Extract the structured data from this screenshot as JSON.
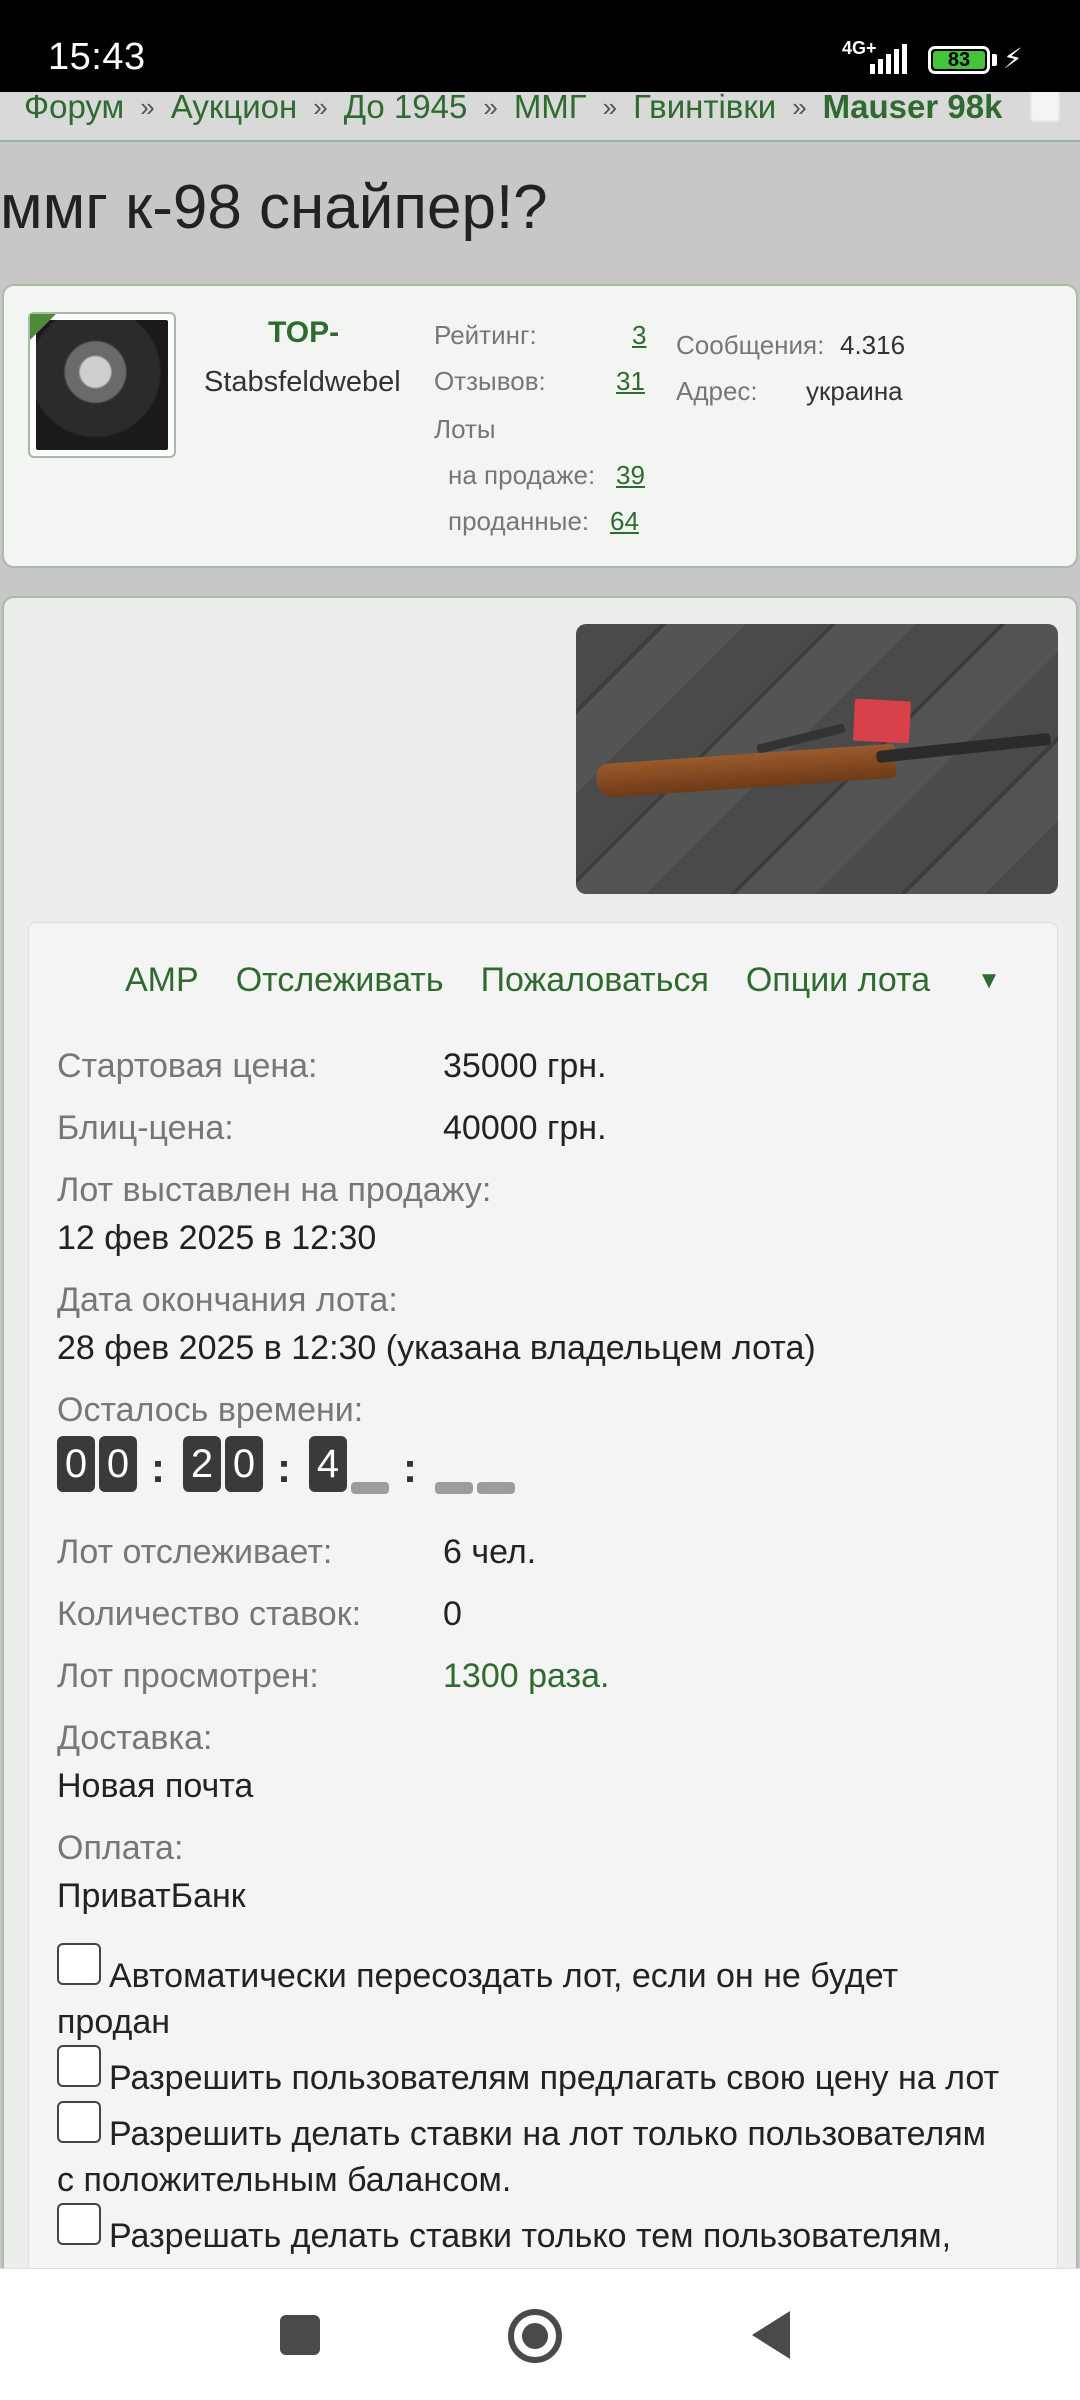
{
  "status_bar": {
    "time": "15:43",
    "network": "4G+",
    "battery": "83"
  },
  "breadcrumb": {
    "items": [
      "Форум",
      "Аукцион",
      "До 1945",
      "ММГ",
      "Гвинтівки"
    ],
    "current": "Mauser 98k",
    "separator": "»"
  },
  "title": "ммг к-98 снайпер!?",
  "seller": {
    "username": "TOP-",
    "rank": "Stabsfeldwebel",
    "rating_label": "Рейтинг:",
    "rating": "3",
    "reviews_label": "Отзывов:",
    "reviews": "31",
    "lots_label": "Лоты",
    "on_sale_label": "на продаже:",
    "on_sale": "39",
    "sold_label": "проданные:",
    "sold": "64",
    "messages_label": "Сообщения:",
    "messages": "4.316",
    "address_label": "Адрес:",
    "address": "украина"
  },
  "actions": {
    "amp": "AMP",
    "watch": "Отслеживать",
    "report": "Пожаловаться",
    "options": "Опции лота"
  },
  "lot": {
    "start_price_label": "Стартовая цена:",
    "start_price": "35000 грн.",
    "blitz_label": "Блиц-цена:",
    "blitz": "40000 грн.",
    "listed_label": "Лот выставлен на продажу:",
    "listed": "12 фев 2025 в 12:30",
    "end_label": "Дата окончания лота:",
    "end": "28 фев 2025 в 12:30 (указана владельцем лота)",
    "remaining_label": "Осталось времени:",
    "timer": {
      "d1": "0",
      "d2": "0",
      "h1": "2",
      "h2": "0",
      "m1": "4",
      "sep": ":"
    },
    "watchers_label": "Лот отслеживает:",
    "watchers": "6 чел.",
    "bids_label": "Количество ставок:",
    "bids": "0",
    "views_label": "Лот просмотрен:",
    "views": "1300 раза.",
    "delivery_label": "Доставка:",
    "delivery": "Новая почта",
    "payment_label": "Оплата:",
    "payment": "ПриватБанк"
  },
  "checkboxes": {
    "c1_line1": "Автоматически пересоздать лот, если он не будет",
    "c1_line2": "продан",
    "c2": "Разрешить пользователям предлагать свою цену на лот",
    "c3_line1": "Разрешить делать ставки на лот только пользователям",
    "c3_line2": "с положительным балансом.",
    "c4_line1": "Разрешать делать ставки только тем пользователям,"
  },
  "colors": {
    "accent": "#2f6b2f",
    "border": "#a7bba7",
    "background": "#c7c7c7"
  }
}
